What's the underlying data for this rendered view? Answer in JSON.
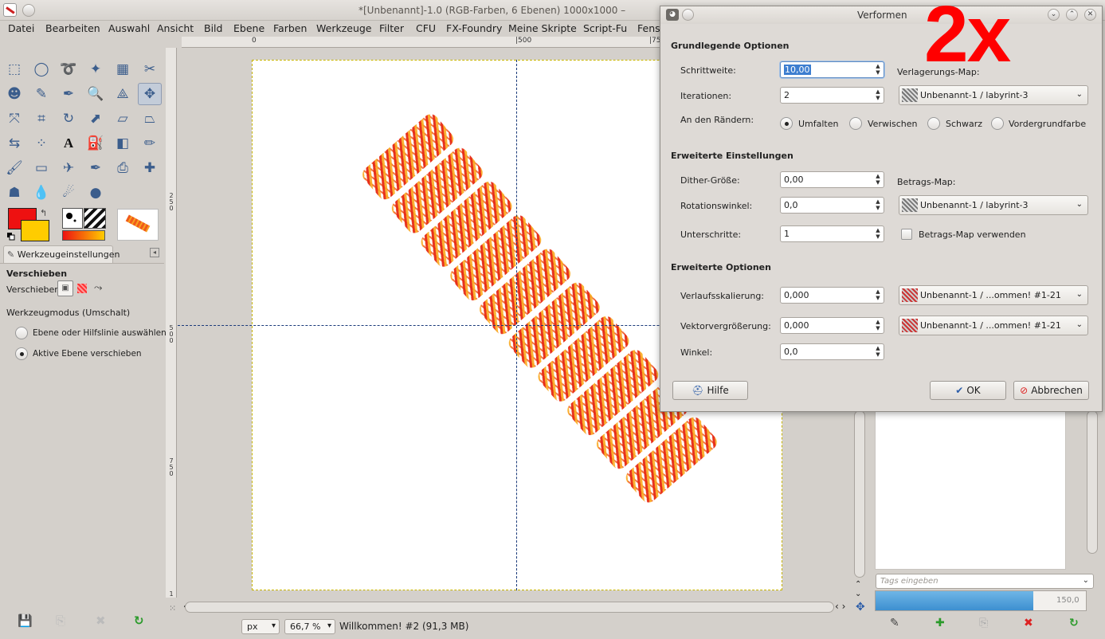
{
  "window": {
    "title": "*[Unbenannt]-1.0 (RGB-Farben, 6 Ebenen) 1000x1000 –"
  },
  "menu": [
    "Datei",
    "Bearbeiten",
    "Auswahl",
    "Ansicht",
    "Bild",
    "Ebene",
    "Farben",
    "Werkzeuge",
    "Filter",
    "CFU",
    "FX-Foundry",
    "Meine Skripte",
    "Script-Fu",
    "Fens"
  ],
  "ruler": {
    "top": [
      "0",
      "|500",
      "|75"
    ],
    "left": [
      "2\n5\n0",
      "5\n0\n0",
      "7\n5\n0",
      "1"
    ]
  },
  "toolbox": {
    "icons": [
      "rect-select-icon",
      "ellipse-select-icon",
      "lasso-icon",
      "fuzzy-select-icon",
      "color-select-icon",
      "scissors-icon",
      "foreground-select-icon",
      "paths-icon",
      "color-picker-icon",
      "zoom-icon",
      "measure-icon",
      "move-icon",
      "align-icon",
      "crop-icon",
      "rotate-icon",
      "scale-icon",
      "shear-icon",
      "perspective-icon",
      "flip-icon",
      "cage-icon",
      "text-icon",
      "bucket-fill-icon",
      "blend-icon",
      "pencil-icon",
      "paintbrush-icon",
      "eraser-icon",
      "airbrush-icon",
      "ink-icon",
      "clone-icon",
      "heal-icon",
      "perspective-clone-icon",
      "blur-icon",
      "smudge-icon",
      "dodge-burn-icon"
    ],
    "glyphs": [
      "⬚",
      "◯",
      "➰",
      "✦",
      "▦",
      "✂",
      "☻",
      "✎",
      "✒",
      "🔍",
      "⟁",
      "✥",
      "⤧",
      "⌗",
      "↻",
      "⬈",
      "▱",
      "⏢",
      "⇆",
      "⁘",
      "A",
      "⛽",
      "◧",
      "✏",
      "🖌",
      "▭",
      "✈",
      "✒",
      "⎙",
      "✚",
      "☗",
      "💧",
      "☄",
      "●"
    ]
  },
  "colors": {
    "foreground": "#ee1111",
    "background": "#ffcc00",
    "swap": "↰"
  },
  "tool_options": {
    "tab": "Werkzeugeinstellungen",
    "title": "Verschieben",
    "move_label": "Verschieben:",
    "mode_label": "Werkzeugmodus (Umschalt)",
    "radio1": "Ebene oder Hilfslinie auswählen",
    "radio2": "Aktive Ebene verschieben"
  },
  "status": {
    "unit": "px",
    "zoom": "66,7 %",
    "text": "Willkommen! #2 (91,3 MB)"
  },
  "dock": {
    "tag_placeholder": "Tags eingeben",
    "size_value": "150,0"
  },
  "dialog": {
    "title": "Verformen",
    "overlay": "2x",
    "basic_section": "Grundlegende Optionen",
    "step_label": "Schrittweite:",
    "step_value": "10,00",
    "iter_label": "Iterationen:",
    "iter_value": "2",
    "displace_map_label": "Verlagerungs-Map:",
    "displace_map_value": "Unbenannt-1 / labyrint-3",
    "edge_label": "An den Rändern:",
    "edge_options": [
      "Umfalten",
      "Verwischen",
      "Schwarz",
      "Vordergrundfarbe"
    ],
    "advanced_settings_section": "Erweiterte Einstellungen",
    "dither_label": "Dither-Größe:",
    "dither_value": "0,00",
    "rotation_label": "Rotationswinkel:",
    "rotation_value": "0,0",
    "substeps_label": "Unterschritte:",
    "substeps_value": "1",
    "magnitude_map_label": "Betrags-Map:",
    "magnitude_map_value": "Unbenannt-1 / labyrint-3",
    "use_magnitude_label": "Betrags-Map verwenden",
    "advanced_options_section": "Erweiterte Optionen",
    "gradient_scale_label": "Verlaufsskalierung:",
    "gradient_scale_value": "0,000",
    "gradient_map_value": "Unbenannt-1 / ...ommen! #1-21",
    "vector_scale_label": "Vektorvergrößerung:",
    "vector_scale_value": "0,000",
    "vector_map_value": "Unbenannt-1 / ...ommen! #1-21",
    "angle_label": "Winkel:",
    "angle_value": "0,0",
    "help_button": "Hilfe",
    "ok_button": "OK",
    "cancel_button": "Abbrechen"
  }
}
